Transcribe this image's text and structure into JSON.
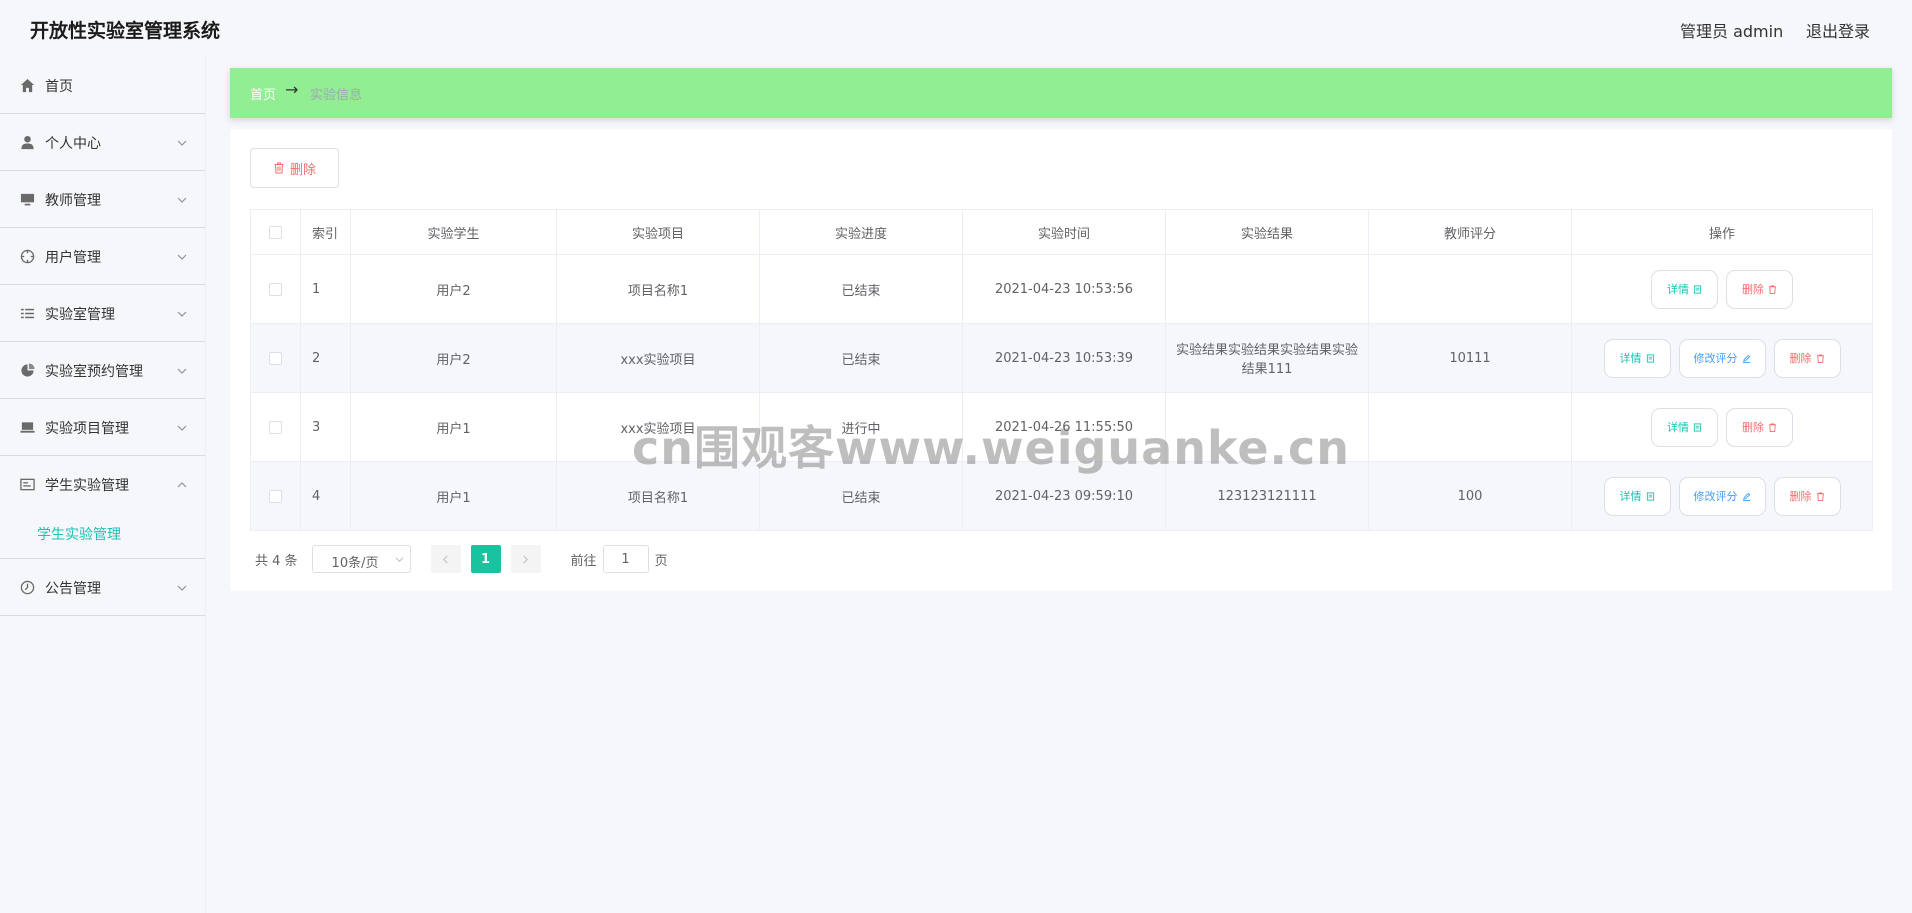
{
  "header": {
    "title": "开放性实验室管理系统",
    "user_label": "管理员 admin",
    "logout": "退出登录"
  },
  "sidebar": {
    "items": [
      {
        "label": "首页",
        "icon": "home-icon"
      },
      {
        "label": "个人中心",
        "icon": "user-icon"
      },
      {
        "label": "教师管理",
        "icon": "monitor-icon"
      },
      {
        "label": "用户管理",
        "icon": "compass-icon"
      },
      {
        "label": "实验室管理",
        "icon": "list-icon"
      },
      {
        "label": "实验室预约管理",
        "icon": "pie-icon"
      },
      {
        "label": "实验项目管理",
        "icon": "laptop-icon"
      },
      {
        "label": "学生实验管理",
        "icon": "card-icon",
        "sub": "学生实验管理"
      },
      {
        "label": "公告管理",
        "icon": "clock-icon"
      }
    ]
  },
  "breadcrumb": {
    "home": "首页",
    "arrow": "→",
    "current": "实验信息"
  },
  "toolbar": {
    "delete_label": "删除"
  },
  "table": {
    "headers": [
      "索引",
      "实验学生",
      "实验项目",
      "实验进度",
      "实验时间",
      "实验结果",
      "教师评分",
      "操作"
    ],
    "rows": [
      {
        "index": "1",
        "student": "用户2",
        "project": "项目名称1",
        "progress": "已结束",
        "time": "2021-04-23 10:53:56",
        "result": "",
        "score": ""
      },
      {
        "index": "2",
        "student": "用户2",
        "project": "xxx实验项目",
        "progress": "已结束",
        "time": "2021-04-23 10:53:39",
        "result": "实验结果实验结果实验结果实验结果111",
        "score": "10111"
      },
      {
        "index": "3",
        "student": "用户1",
        "project": "xxx实验项目",
        "progress": "进行中",
        "time": "2021-04-26 11:55:50",
        "result": "",
        "score": ""
      },
      {
        "index": "4",
        "student": "用户1",
        "project": "项目名称1",
        "progress": "已结束",
        "time": "2021-04-23 09:59:10",
        "result": "123123121111",
        "score": "100"
      }
    ],
    "actions": {
      "detail": "详情",
      "edit": "修改评分",
      "delete": "删除"
    }
  },
  "pagination": {
    "total": "共 4 条",
    "page_size": "10条/页",
    "current_page": "1",
    "goto_label": "前往",
    "goto_value": "1",
    "page_suffix": "页"
  },
  "watermark": "cn围观客www.weiguanke.cn",
  "colors": {
    "accent": "#19c3b2",
    "breadcrumb_bg": "#92ee92",
    "danger": "#f56c6c",
    "primary": "#409eff"
  }
}
